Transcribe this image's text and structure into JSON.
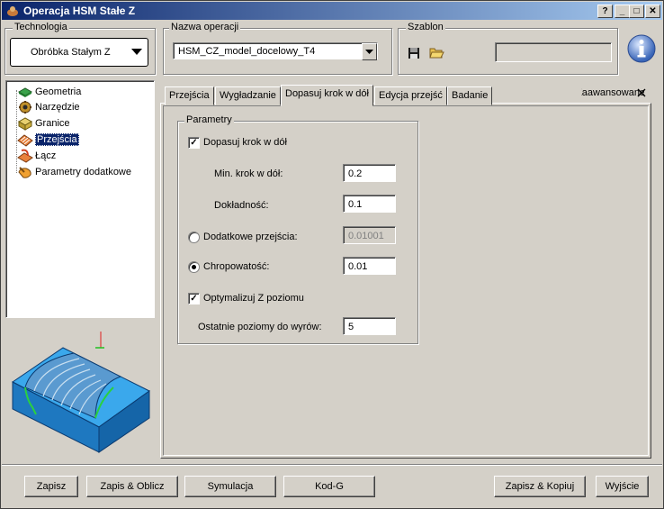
{
  "window": {
    "title": "Operacja HSM Stałe Z",
    "buttons": [
      "?",
      "_",
      "□",
      "✕"
    ]
  },
  "technologia": {
    "label": "Technologia",
    "value": "Obróbka Stałym Z"
  },
  "nazwa": {
    "label": "Nazwa operacji",
    "value": "HSM_CZ_model_docelowy_T4"
  },
  "szablon": {
    "label": "Szablon",
    "value": ""
  },
  "tree": {
    "items": [
      {
        "label": "Geometria",
        "icon": "geometry-icon"
      },
      {
        "label": "Narzędzie",
        "icon": "tool-icon"
      },
      {
        "label": "Granice",
        "icon": "boundary-icon"
      },
      {
        "label": "Przejścia",
        "icon": "passes-icon"
      },
      {
        "label": "Łącz",
        "icon": "link-icon"
      },
      {
        "label": "Parametry dodatkowe",
        "icon": "extra-params-icon"
      }
    ],
    "selected": 3
  },
  "tabs": {
    "items": [
      "Przejścia",
      "Wygładzanie",
      "Dopasuj krok w dół",
      "Edycja przejść",
      "Badanie"
    ],
    "active": 2,
    "advanced": "Zaawansowane"
  },
  "params": {
    "group_label": "Parametry",
    "adjust_step": {
      "label": "Dopasuj krok w dół",
      "checked": true
    },
    "min_step": {
      "label": "Min. krok w dół:",
      "value": "0.2"
    },
    "accuracy": {
      "label": "Dokładność:",
      "value": "0.1"
    },
    "extra_passes": {
      "label": "Dodatkowe przejścia:",
      "value": "0.01001",
      "selected": false
    },
    "roughness": {
      "label": "Chropowatość:",
      "value": "0.01",
      "selected": true
    },
    "optimize": {
      "label": "Optymalizuj Z poziomu",
      "checked": true
    },
    "last_levels": {
      "label": "Ostatnie poziomy do wyrów:",
      "value": "5"
    }
  },
  "footer": {
    "save": "Zapisz",
    "save_calc": "Zapis & Oblicz",
    "simulation": "Symulacja",
    "gcode": "Kod-G",
    "save_copy": "Zapisz & Kopiuj",
    "exit": "Wyjście"
  },
  "colors": {
    "titlebar": "#0a246a",
    "selection": "#0a246a",
    "preview_bg": "#d4d0c8",
    "part_blue": "#2a8fd6"
  }
}
